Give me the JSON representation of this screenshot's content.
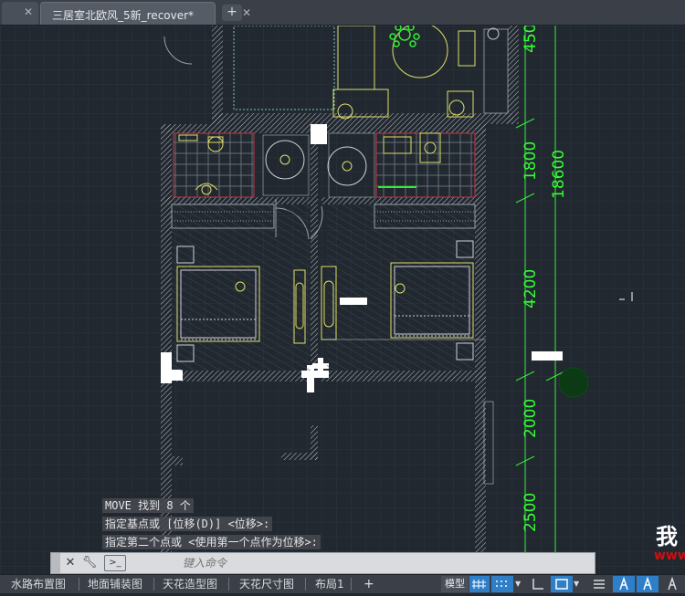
{
  "document_tabs": [
    {
      "title": ""
    },
    {
      "title": "三居室北欧风_5新_recover*",
      "active": true
    }
  ],
  "new_tab_symbol": "+",
  "drawing": {
    "dimensions_outer": [
      "450",
      "1800",
      "4200",
      "2000",
      "2500"
    ],
    "dimension_total": "18600"
  },
  "command_history": [
    "MOVE 找到 8 个",
    "指定基点或 [位移(D)] <位移>:",
    "指定第二个点或 <使用第一个点作为位移>:"
  ],
  "command_input": {
    "placeholder": "键入命令"
  },
  "layout_tabs": [
    "水路布置图",
    "地面铺装图",
    "天花造型图",
    "天花尺寸图",
    "布局1"
  ],
  "status": {
    "model_label": "模型"
  },
  "watermark": {
    "char": "我",
    "url_fragment": "www"
  },
  "colors": {
    "canvas_bg": "#212830",
    "dimension": "#33ff33",
    "furniture": "#e0e066",
    "walls": "#c8c8c8"
  }
}
